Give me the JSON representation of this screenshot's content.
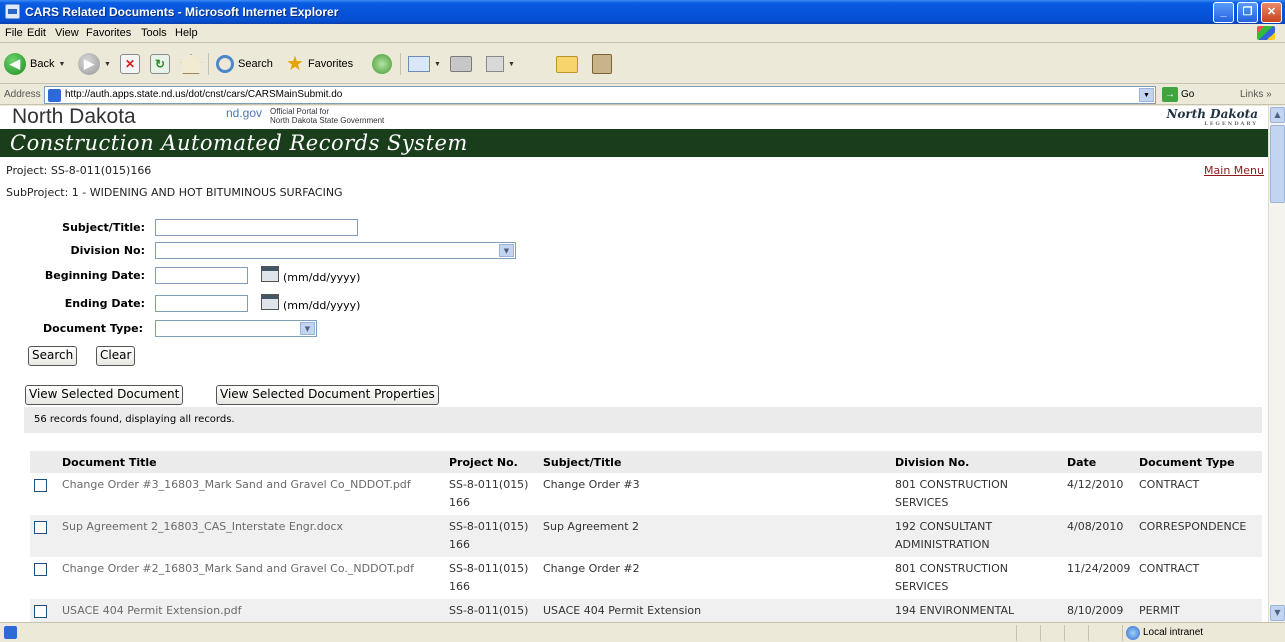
{
  "window": {
    "title": "CARS Related Documents - Microsoft Internet Explorer"
  },
  "menu": [
    "File",
    "Edit",
    "View",
    "Favorites",
    "Tools",
    "Help"
  ],
  "toolbar": {
    "back_label": "Back",
    "search_label": "Search",
    "favorites_label": "Favorites"
  },
  "address": {
    "label": "Address",
    "url": "http://auth.apps.state.nd.us/dot/cnst/cars/CARSMainSubmit.do",
    "go_label": "Go",
    "links_label": "Links"
  },
  "header": {
    "state_name": "North Dakota",
    "ndgov": "nd.gov",
    "portal_line1": "Official Portal for",
    "portal_line2": "North Dakota State Government",
    "logo_text": "North Dakota",
    "logo_sub": "LEGENDARY",
    "banner_title": "Construction Automated Records System"
  },
  "project": {
    "project_line": "Project: SS-8-011(015)166",
    "subproject_line": "SubProject: 1 - WIDENING AND HOT BITUMINOUS SURFACING",
    "main_menu_link": "Main Menu"
  },
  "form": {
    "subject_label": "Subject/Title:",
    "subject_value": "",
    "division_label": "Division No:",
    "division_value": "",
    "begin_label": "Beginning Date:",
    "begin_value": "",
    "end_label": "Ending Date:",
    "end_value": "",
    "date_hint": "(mm/dd/yyyy)",
    "doctype_label": "Document Type:",
    "doctype_value": "",
    "search_button": "Search",
    "clear_button": "Clear",
    "view_doc_button": "View Selected Document",
    "view_props_button": "View Selected Document Properties"
  },
  "results": {
    "summary": "56 records found, displaying all records.",
    "columns": [
      "Document Title",
      "Project No.",
      "Subject/Title",
      "Division No.",
      "Date",
      "Document Type"
    ],
    "rows": [
      {
        "title": "Change Order #3_16803_Mark Sand and Gravel Co_NDDOT.pdf",
        "project_a": "SS-8-011(015)",
        "project_b": "166",
        "subject": "Change Order #3",
        "division_a": "801 CONSTRUCTION",
        "division_b": "SERVICES",
        "date": "4/12/2010",
        "doctype": "CONTRACT"
      },
      {
        "title": "Sup Agreement 2_16803_CAS_Interstate Engr.docx",
        "project_a": "SS-8-011(015)",
        "project_b": "166",
        "subject": "Sup Agreement 2",
        "division_a": "192 CONSULTANT",
        "division_b": "ADMINISTRATION",
        "date": "4/08/2010",
        "doctype": "CORRESPONDENCE"
      },
      {
        "title": "Change Order #2_16803_Mark Sand and Gravel Co._NDDOT.pdf",
        "project_a": "SS-8-011(015)",
        "project_b": "166",
        "subject": "Change Order #2",
        "division_a": "801 CONSTRUCTION",
        "division_b": "SERVICES",
        "date": "11/24/2009",
        "doctype": "CONTRACT"
      },
      {
        "title": "USACE 404 Permit Extension.pdf",
        "project_a": "SS-8-011(015)",
        "project_b": "",
        "subject": "USACE 404 Permit Extension",
        "division_a": "194 ENVIRONMENTAL",
        "division_b": "",
        "date": "8/10/2009",
        "doctype": "PERMIT"
      }
    ]
  },
  "status": {
    "zone": "Local intranet"
  }
}
